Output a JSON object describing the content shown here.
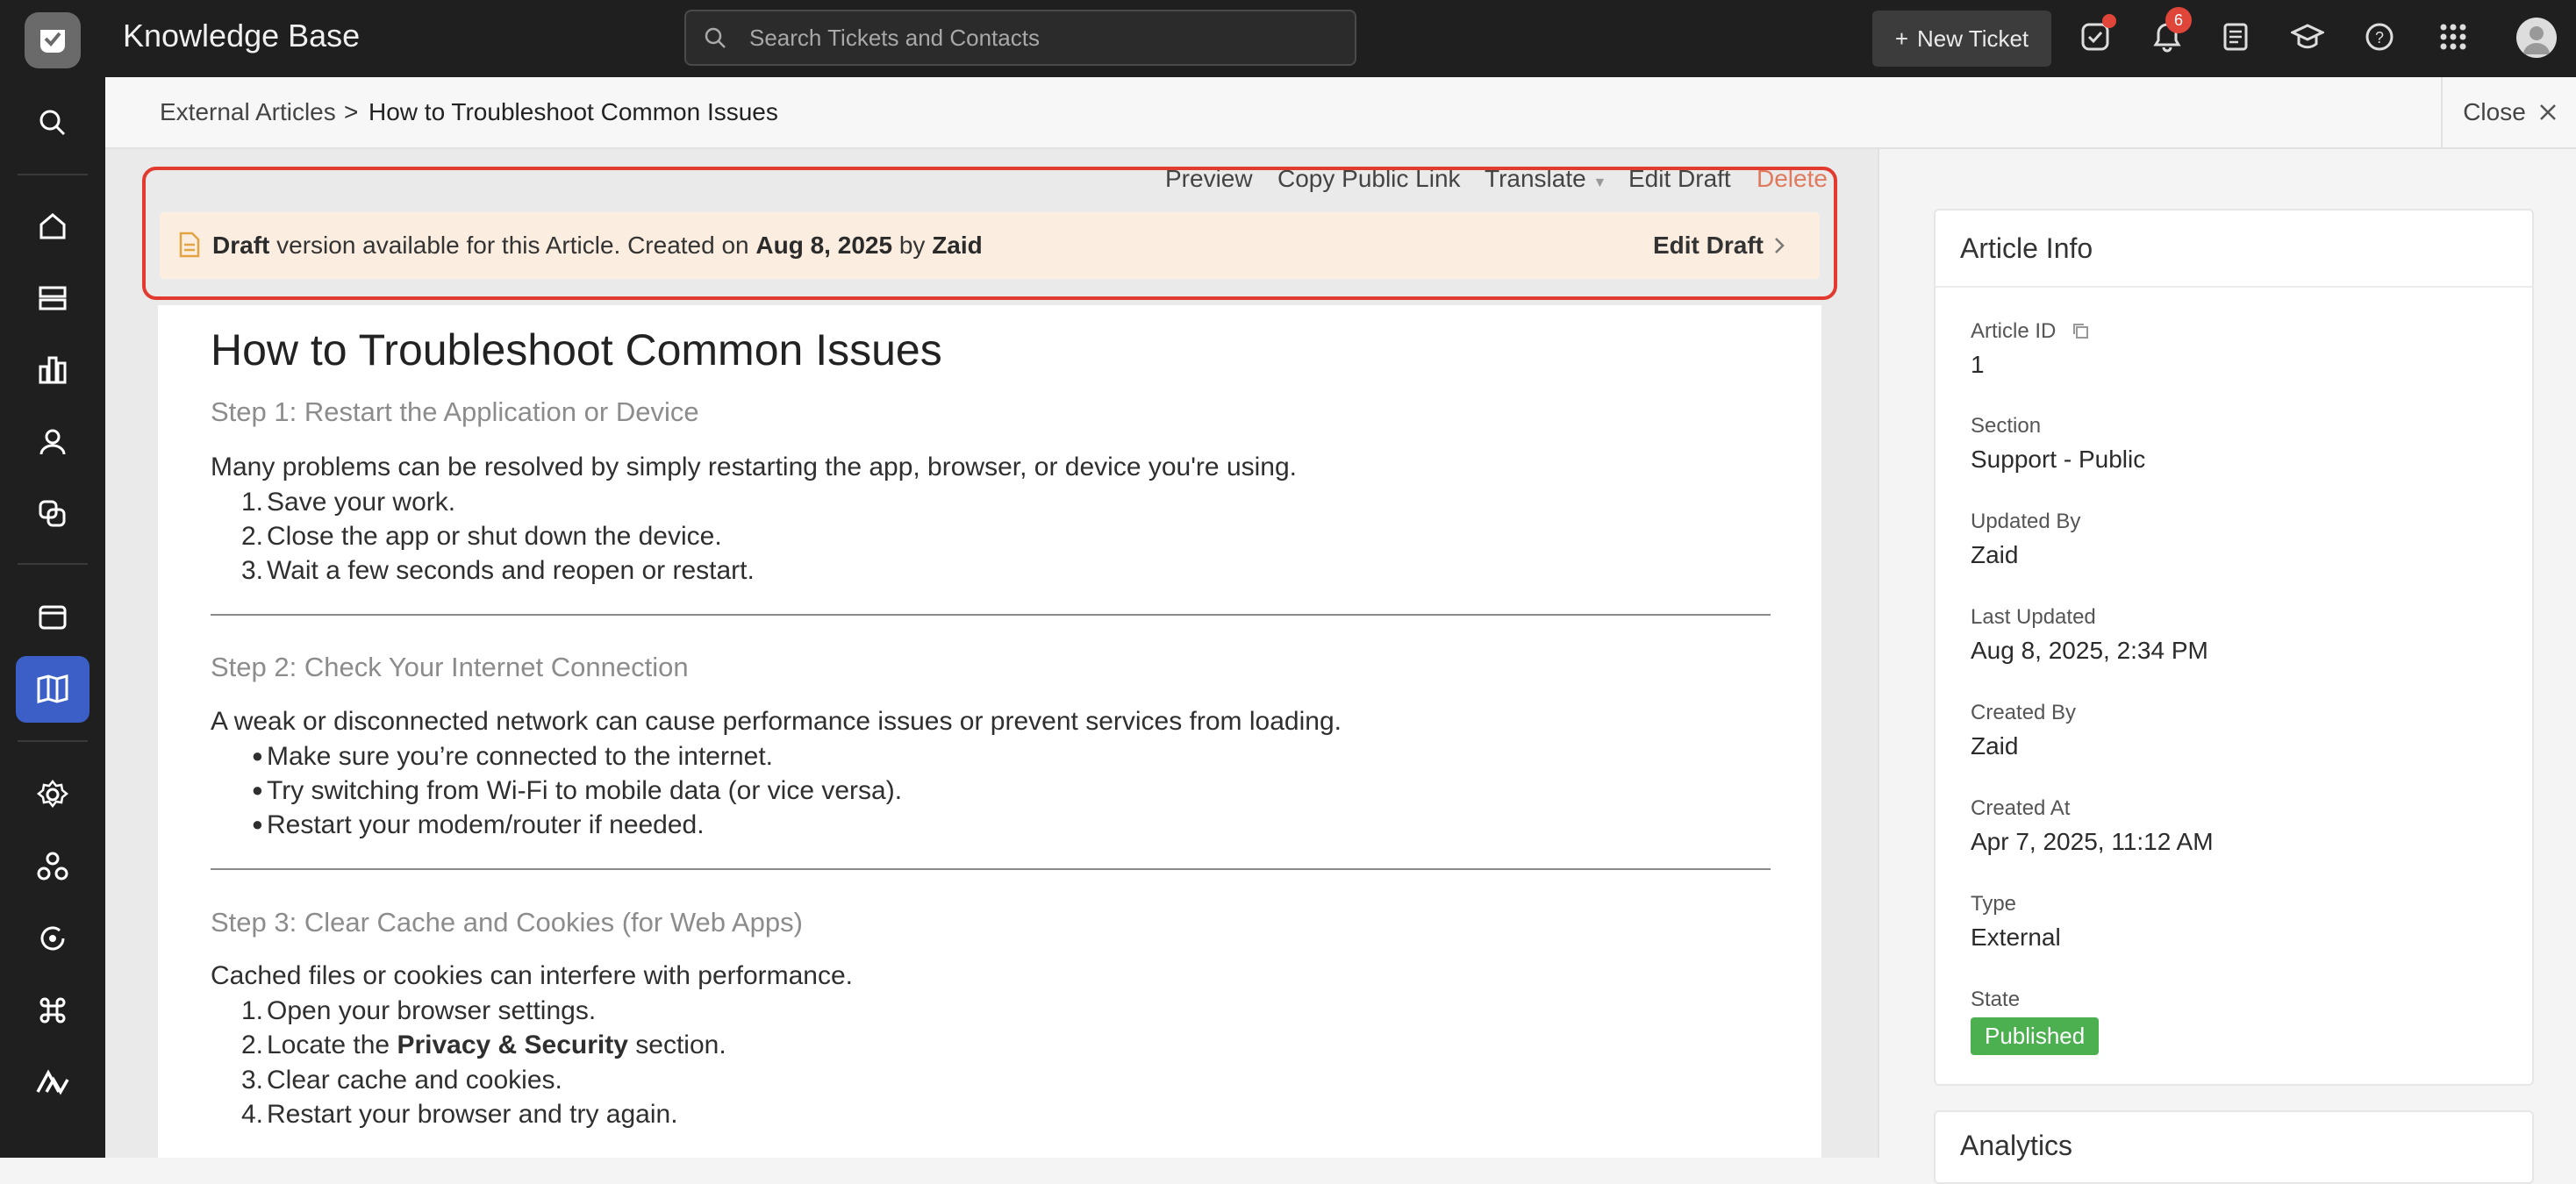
{
  "app": {
    "title": "Knowledge Base"
  },
  "search": {
    "placeholder": "Search Tickets and Contacts"
  },
  "topbar": {
    "new_ticket_label": "New Ticket",
    "notifications_count": "6"
  },
  "breadcrumb": {
    "parent": "External Articles",
    "separator": ">",
    "current": "How to Troubleshoot Common Issues",
    "close_label": "Close"
  },
  "actions": {
    "preview": "Preview",
    "copy_link": "Copy Public Link",
    "translate": "Translate",
    "edit_draft": "Edit Draft",
    "delete": "Delete"
  },
  "draft_banner": {
    "draft_word": "Draft",
    "text_mid": " version available for this Article. Created on ",
    "date": "Aug 8, 2025",
    "by": " by ",
    "author": "Zaid",
    "edit_label": "Edit Draft"
  },
  "article": {
    "title": "How to Troubleshoot Common Issues",
    "step1": {
      "heading": "Step 1: Restart the Application or Device",
      "intro": "Many problems can be resolved by simply restarting the app, browser, or device you're using.",
      "items": [
        "Save your work.",
        "Close the app or shut down the device.",
        "Wait a few seconds and reopen or restart."
      ]
    },
    "step2": {
      "heading": "Step 2: Check Your Internet Connection",
      "intro": "A weak or disconnected network can cause performance issues or prevent services from loading.",
      "items": [
        "Make sure you’re connected to the internet.",
        "Try switching from Wi-Fi to mobile data (or vice versa).",
        "Restart your modem/router if needed."
      ]
    },
    "step3": {
      "heading": "Step 3: Clear Cache and Cookies (for Web Apps)",
      "intro": "Cached files or cookies can interfere with performance.",
      "item1": "Open your browser settings.",
      "item2_pre": "Locate the ",
      "item2_bold": "Privacy & Security",
      "item2_post": " section.",
      "item3": "Clear cache and cookies.",
      "item4": "Restart your browser and try again."
    }
  },
  "info": {
    "title": "Article Info",
    "article_id_label": "Article ID",
    "article_id": "1",
    "section_label": "Section",
    "section": "Support - Public",
    "updated_by_label": "Updated By",
    "updated_by": "Zaid",
    "last_updated_label": "Last Updated",
    "last_updated": "Aug 8, 2025, 2:34 PM",
    "created_by_label": "Created By",
    "created_by": "Zaid",
    "created_at_label": "Created At",
    "created_at": "Apr 7, 2025, 11:12 AM",
    "type_label": "Type",
    "type": "External",
    "state_label": "State",
    "state": "Published"
  },
  "analytics": {
    "title": "Analytics"
  },
  "colors": {
    "accent": "#3b5fc6",
    "highlight": "#e23a2f",
    "published": "#4caf50",
    "draft_bg": "#fbeee0"
  }
}
